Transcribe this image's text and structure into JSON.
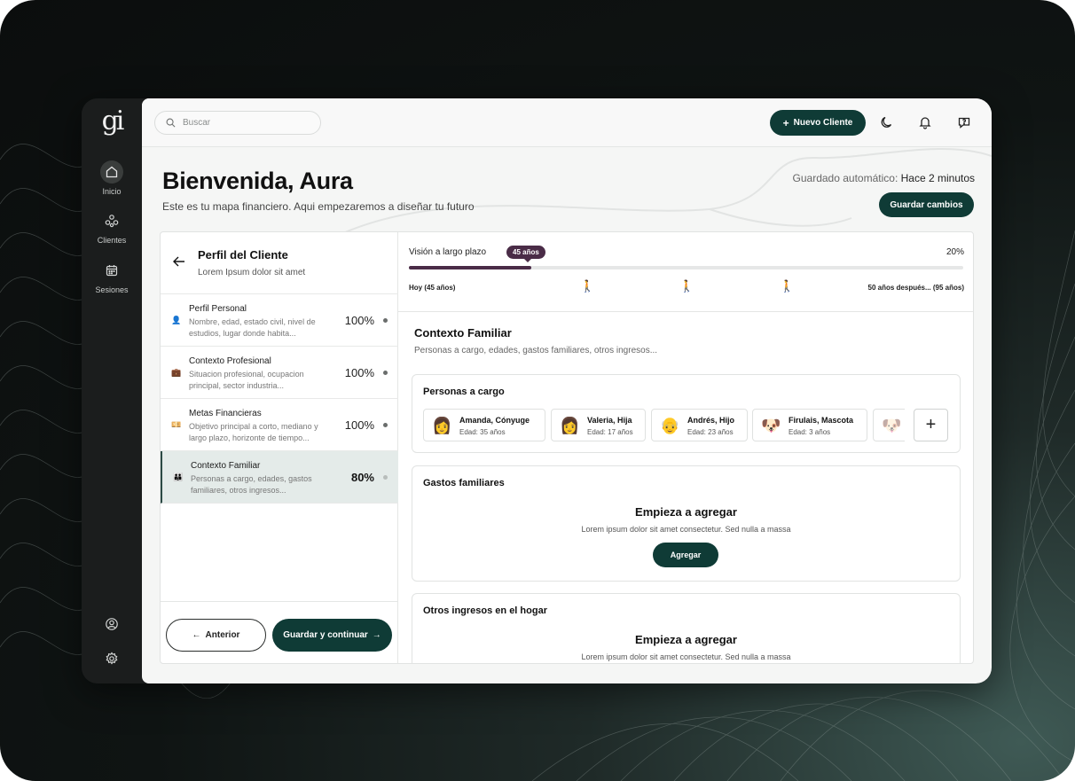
{
  "sidebar": {
    "logo": "gi",
    "items": [
      {
        "label": "Inicio",
        "icon": "home-icon",
        "active": true
      },
      {
        "label": "Clientes",
        "icon": "clients-icon",
        "active": false
      },
      {
        "label": "Sesiones",
        "icon": "calendar-icon",
        "active": false
      }
    ],
    "bottom_icons": [
      "user-icon",
      "gear-icon"
    ]
  },
  "topbar": {
    "search_placeholder": "Buscar",
    "new_client_label": "Nuevo Cliente",
    "icons": [
      "moon-icon",
      "bell-icon",
      "help-icon"
    ]
  },
  "header": {
    "title": "Bienvenida, Aura",
    "subtitle": "Este es tu mapa financiero. Aqui empezaremos a diseñar tu futuro",
    "autosave_label": "Guardado automático:",
    "autosave_value": "Hace 2 minutos",
    "save_button": "Guardar cambios"
  },
  "profile_panel": {
    "title": "Perfil del Cliente",
    "subtitle": "Lorem Ipsum dolor sit amet",
    "steps": [
      {
        "title": "Perfil Personal",
        "desc": "Nombre, edad, estado civil, nivel de estudios, lugar donde habita...",
        "percent": "100%",
        "icon": "👤",
        "active": false
      },
      {
        "title": "Contexto Profesional",
        "desc": "Situacion profesional, ocupacion principal, sector industria...",
        "percent": "100%",
        "icon": "💼",
        "active": false
      },
      {
        "title": "Metas Financieras",
        "desc": "Objetivo principal a corto, mediano y largo plazo, horizonte de tiempo...",
        "percent": "100%",
        "icon": "💴",
        "active": false
      },
      {
        "title": "Contexto Familiar",
        "desc": "Personas a cargo, edades, gastos familiares, otros ingresos...",
        "percent": "80%",
        "icon": "👪",
        "active": true
      }
    ],
    "prev_button": "Anterior",
    "next_button": "Guardar y continuar"
  },
  "vision": {
    "label": "Visión a largo plazo",
    "badge": "45 años",
    "percent": "20%",
    "progress": 0.22,
    "start_label": "Hoy (45 años)",
    "end_label": "50 años después... (95 años)"
  },
  "family": {
    "title": "Contexto Familiar",
    "subtitle": "Personas a cargo, edades, gastos familiares, otros ingresos...",
    "dependents": {
      "title": "Personas a cargo",
      "people": [
        {
          "name": "Amanda, Cónyuge",
          "age": "Edad: 35 años",
          "emoji": "👩"
        },
        {
          "name": "Valeria, Hija",
          "age": "Edad: 17 años",
          "emoji": "👩"
        },
        {
          "name": "Andrés, Hijo",
          "age": "Edad: 23 años",
          "emoji": "👴"
        },
        {
          "name": "Firulais, Mascota",
          "age": "Edad: 3 años",
          "emoji": "🐶"
        }
      ]
    },
    "expenses": {
      "title": "Gastos familiares",
      "empty_title": "Empieza a agregar",
      "empty_text": "Lorem ipsum dolor sit amet consectetur. Sed nulla a massa",
      "button": "Agregar"
    },
    "other_income": {
      "title": "Otros ingresos en el hogar",
      "empty_title": "Empieza a agregar",
      "empty_text": "Lorem ipsum dolor sit amet consectetur. Sed nulla a massa"
    }
  },
  "colors": {
    "accent": "#0f3b36",
    "progress": "#4a2c47",
    "active_step_bg": "#e4ebe9"
  }
}
